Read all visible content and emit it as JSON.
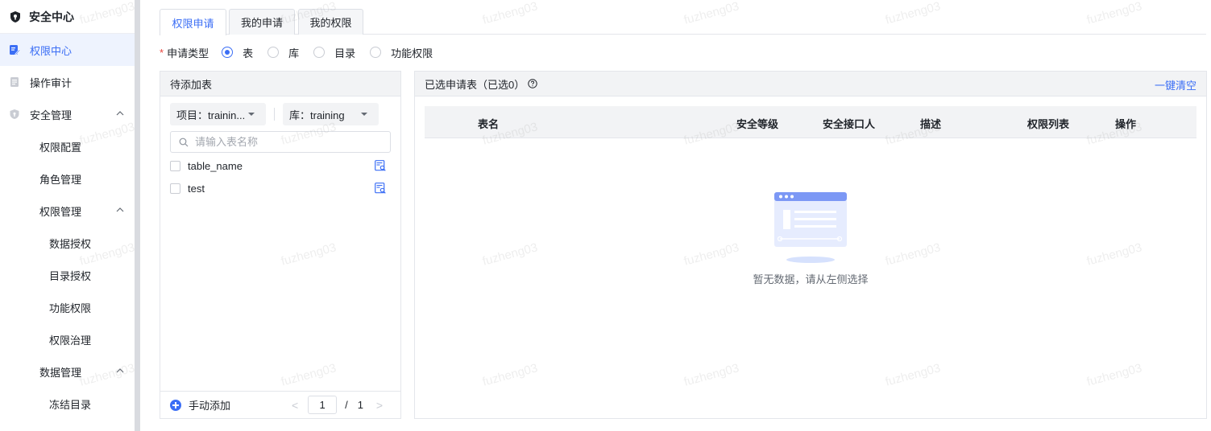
{
  "sidebar": {
    "title": "安全中心",
    "items": [
      {
        "label": "权限中心"
      },
      {
        "label": "操作审计"
      },
      {
        "label": "安全管理"
      },
      {
        "label": "权限配置"
      },
      {
        "label": "角色管理"
      },
      {
        "label": "权限管理"
      },
      {
        "label": "数据授权"
      },
      {
        "label": "目录授权"
      },
      {
        "label": "功能权限"
      },
      {
        "label": "权限治理"
      },
      {
        "label": "数据管理"
      },
      {
        "label": "冻结目录"
      }
    ]
  },
  "tabs": [
    {
      "label": "权限申请"
    },
    {
      "label": "我的申请"
    },
    {
      "label": "我的权限"
    }
  ],
  "apply_type": {
    "star": "*",
    "label": "申请类型",
    "options": [
      {
        "label": "表"
      },
      {
        "label": "库"
      },
      {
        "label": "目录"
      },
      {
        "label": "功能权限"
      }
    ]
  },
  "left_panel": {
    "title": "待添加表",
    "project_select": "项目：trainin...",
    "db_select": "库：training",
    "search_placeholder": "请输入表名称",
    "tables": [
      {
        "name": "table_name"
      },
      {
        "name": "test"
      }
    ],
    "add_label": "手动添加",
    "pager": {
      "prev": "<",
      "current": "1",
      "sep": "/",
      "total": "1",
      "next": ">"
    }
  },
  "right_panel": {
    "title": "已选申请表（已选0）",
    "clear_label": "一键清空",
    "columns": [
      "表名",
      "安全等级",
      "安全接口人",
      "描述",
      "权限列表",
      "操作"
    ],
    "empty_text": "暂无数据，请从左侧选择"
  },
  "watermark": "fuzheng03",
  "colors": {
    "accent": "#3b6ef5",
    "active_bg": "#eef3fe",
    "required": "#e8453c"
  }
}
